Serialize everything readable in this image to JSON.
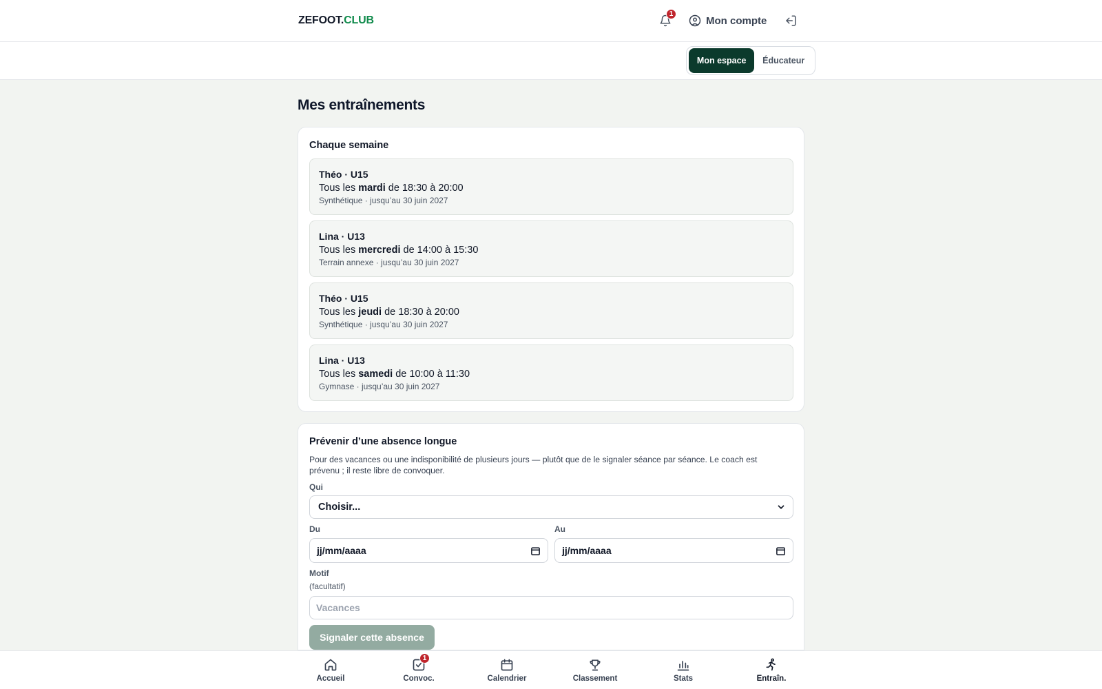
{
  "header": {
    "brand_main": "ZEFOOT.",
    "brand_accent": "CLUB",
    "notification_count": "1",
    "account_label": "Mon compte"
  },
  "switcher": {
    "active_label": "Mon espace",
    "other_label": "Éducateur"
  },
  "page": {
    "title": "Mes entraînements"
  },
  "weekly": {
    "title": "Chaque semaine",
    "sessions": [
      {
        "who": "Théo · U15",
        "prefix": "Tous les ",
        "day": "mardi",
        "time": " de 18:30 à 20:00",
        "meta": "Synthétique · jusqu’au 30 juin 2027"
      },
      {
        "who": "Lina · U13",
        "prefix": "Tous les ",
        "day": "mercredi",
        "time": " de 14:00 à 15:30",
        "meta": "Terrain annexe · jusqu’au 30 juin 2027"
      },
      {
        "who": "Théo · U15",
        "prefix": "Tous les ",
        "day": "jeudi",
        "time": " de 18:30 à 20:00",
        "meta": "Synthétique · jusqu’au 30 juin 2027"
      },
      {
        "who": "Lina · U13",
        "prefix": "Tous les ",
        "day": "samedi",
        "time": " de 10:00 à 11:30",
        "meta": "Gymnase · jusqu’au 30 juin 2027"
      }
    ]
  },
  "absence": {
    "title": "Prévenir d’une absence longue",
    "description": "Pour des vacances ou une indisponibilité de plusieurs jours — plutôt que de le signaler séance par séance. Le coach est prévenu ; il reste libre de convoquer.",
    "who_label": "Qui",
    "who_value": "Choisir...",
    "from_label": "Du",
    "from_value": "jj/mm/aaaa",
    "to_label": "Au",
    "to_value": "jj/mm/aaaa",
    "reason_label": "Motif",
    "reason_hint": "(facultatif)",
    "reason_placeholder": "Vacances",
    "submit_label": "Signaler cette absence"
  },
  "bottom_nav": {
    "items": [
      {
        "label": "Accueil",
        "icon": "home-icon"
      },
      {
        "label": "Convoc.",
        "icon": "check-square-icon",
        "badge": "1"
      },
      {
        "label": "Calendrier",
        "icon": "calendar-icon"
      },
      {
        "label": "Classement",
        "icon": "trophy-icon"
      },
      {
        "label": "Stats",
        "icon": "bar-chart-icon"
      },
      {
        "label": "Entraîn.",
        "icon": "running-icon",
        "active": true
      }
    ]
  },
  "colors": {
    "accent": "#0f8a4b",
    "dark_green": "#0b3a2c",
    "badge_red": "#c0262d",
    "button_disabled": "#93aba1",
    "page_bg": "#f2f4f1"
  }
}
